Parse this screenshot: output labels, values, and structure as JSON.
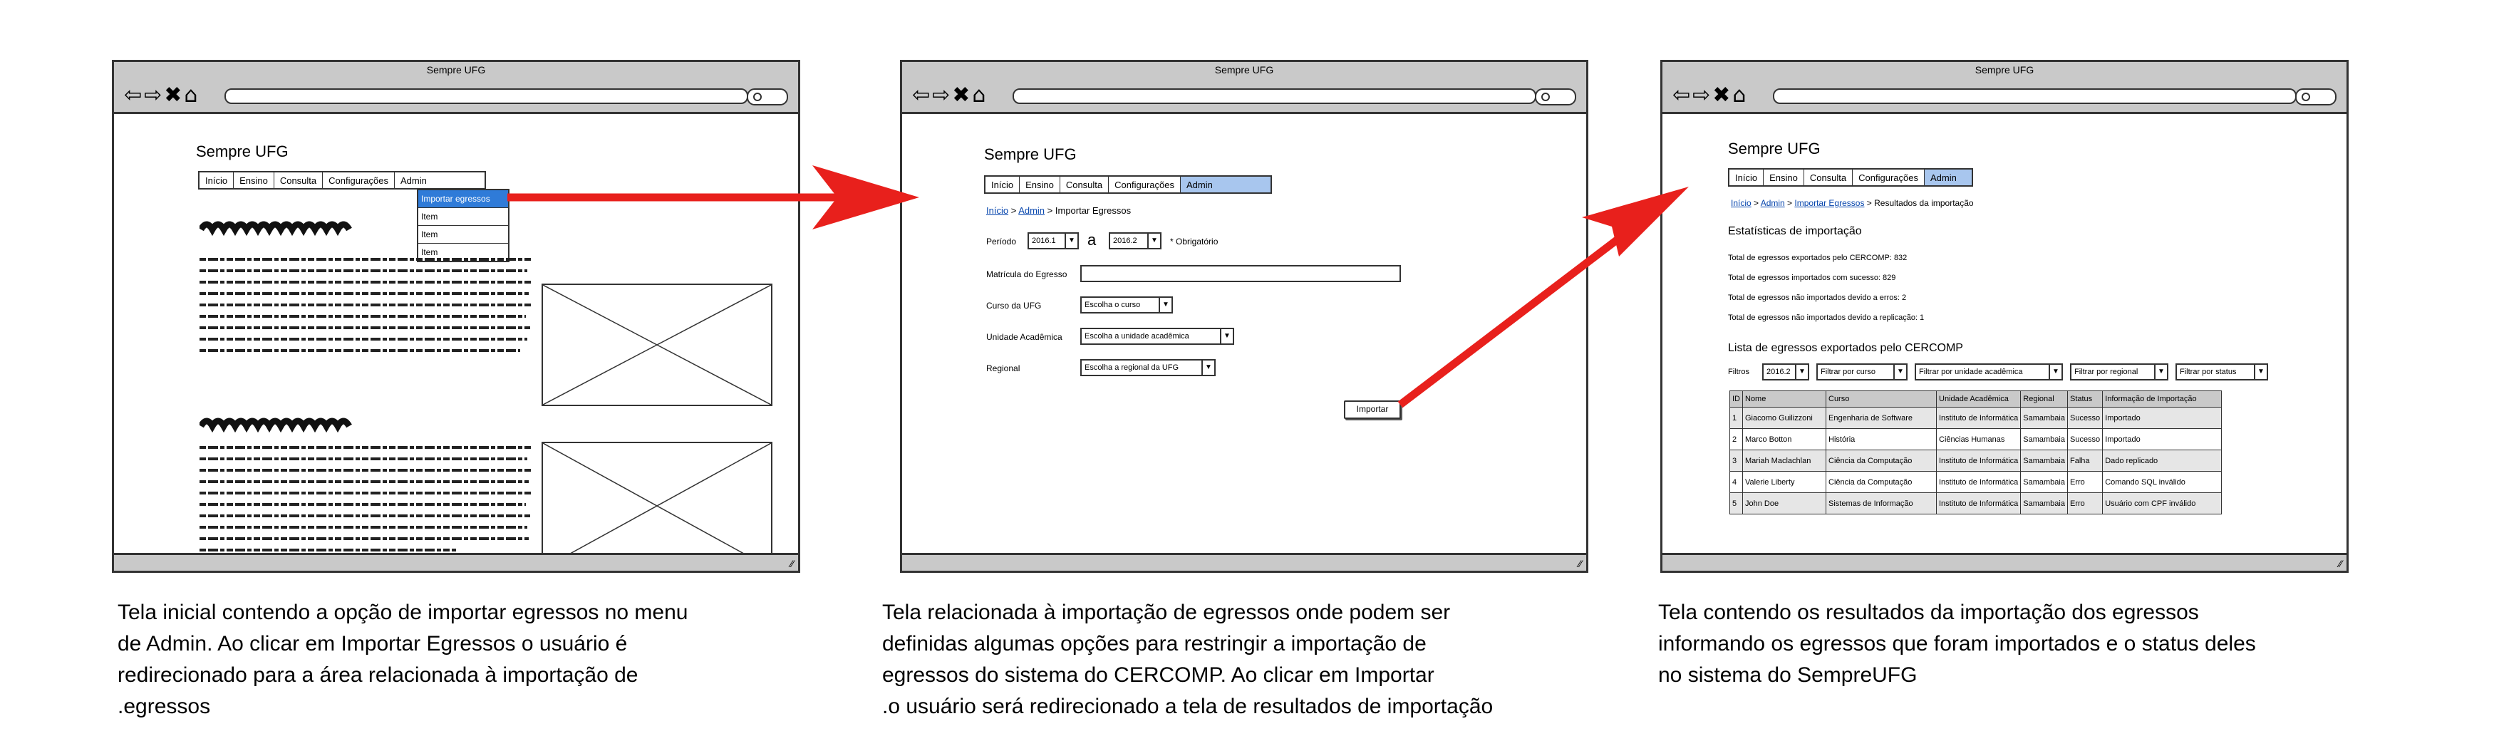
{
  "app_title": "Sempre UFG",
  "nav_buttons": "⇦⇨✖⌂",
  "menu_items": [
    "Início",
    "Ensino",
    "Consulta",
    "Configurações",
    "Admin"
  ],
  "screen1": {
    "window_title": "Sempre UFG",
    "page_title": "Sempre UFG",
    "dropdown_items": [
      "Importar egressos",
      "Item",
      "Item",
      "Item"
    ],
    "caption_lines": [
      "Tela inicial contendo a opção de importar egressos no menu",
      "de Admin. Ao clicar em Importar Egressos o usuário é",
      "redirecionado para a área relacionada à importação de",
      ".egressos"
    ]
  },
  "screen2": {
    "window_title": "Sempre UFG",
    "page_title": "Sempre UFG",
    "breadcrumb": {
      "link1": "Início",
      "link2": "Admin",
      "current": "Importar Egressos",
      "sep": " > "
    },
    "periodo_label": "Período",
    "periodo_start": "2016.1",
    "periodo_sep": "a",
    "periodo_end": "2016.2",
    "required_note": "* Obrigatório",
    "matricula_label": "Matrícula do Egresso",
    "curso_label": "Curso da UFG",
    "curso_select": "Escolha o curso",
    "unidade_label": "Unidade Acadêmica",
    "unidade_select": "Escolha a unidade acadêmica",
    "regional_label": "Regional",
    "regional_select": "Escolha a regional da UFG",
    "import_button": "Importar",
    "caption_lines": [
      "Tela relacionada à importação de egressos onde podem ser",
      "definidas algumas opções para restringir a importação de",
      "egressos do sistema do CERCOMP. Ao clicar em Importar",
      ".o usuário será redirecionado a tela de resultados de importação"
    ]
  },
  "screen3": {
    "window_title": "Sempre UFG",
    "page_title": "Sempre UFG",
    "breadcrumb": {
      "link1": "Início",
      "link2": "Admin",
      "link3": "Importar Egressos",
      "current": "Resultados da importação",
      "sep": " > "
    },
    "stats_title": "Estatísticas de importação",
    "stats": [
      "Total de egressos exportados pelo CERCOMP: 832",
      "Total de egressos importados com sucesso: 829",
      "Total de egressos não importados devido a erros: 2",
      "Total de egressos não importados devido a replicação: 1"
    ],
    "list_title": "Lista de egressos exportados pelo CERCOMP",
    "filters_label": "Filtros",
    "filters": [
      "2016.2",
      "Filtrar por curso",
      "Filtrar por unidade acadêmica",
      "Filtrar por regional",
      "Filtrar por status"
    ],
    "table_headers": [
      "ID",
      "Nome",
      "Curso",
      "Unidade Acadêmica",
      "Regional",
      "Status",
      "Informação de Importação"
    ],
    "table_rows": [
      [
        "1",
        "Giacomo Guilizzoni",
        "Engenharia de Software",
        "Instituto de Informática",
        "Samambaia",
        "Sucesso",
        "Importado"
      ],
      [
        "2",
        "Marco Botton",
        "História",
        "Ciências Humanas",
        "Samambaia",
        "Sucesso",
        "Importado"
      ],
      [
        "3",
        "Mariah Maclachlan",
        "Ciência da Computação",
        "Instituto de Informática",
        "Samambaia",
        "Falha",
        "Dado replicado"
      ],
      [
        "4",
        "Valerie Liberty",
        "Ciência da Computação",
        "Instituto de Informática",
        "Samambaia",
        "Erro",
        "Comando SQL inválido"
      ],
      [
        "5",
        "John Doe",
        "Sistemas de Informação",
        "Instituto de Informática",
        "Samambaia",
        "Erro",
        "Usuário com CPF inválido"
      ]
    ],
    "caption_lines": [
      "Tela contendo os resultados da importação dos egressos",
      "informando os egressos que foram importados e o status deles",
      "no sistema do SempreUFG"
    ]
  },
  "colors": {
    "arrow": "#e8201c",
    "selected_tab": "#a8c6ee",
    "highlight": "#2f7bd8",
    "chrome": "#c9c9c9"
  }
}
